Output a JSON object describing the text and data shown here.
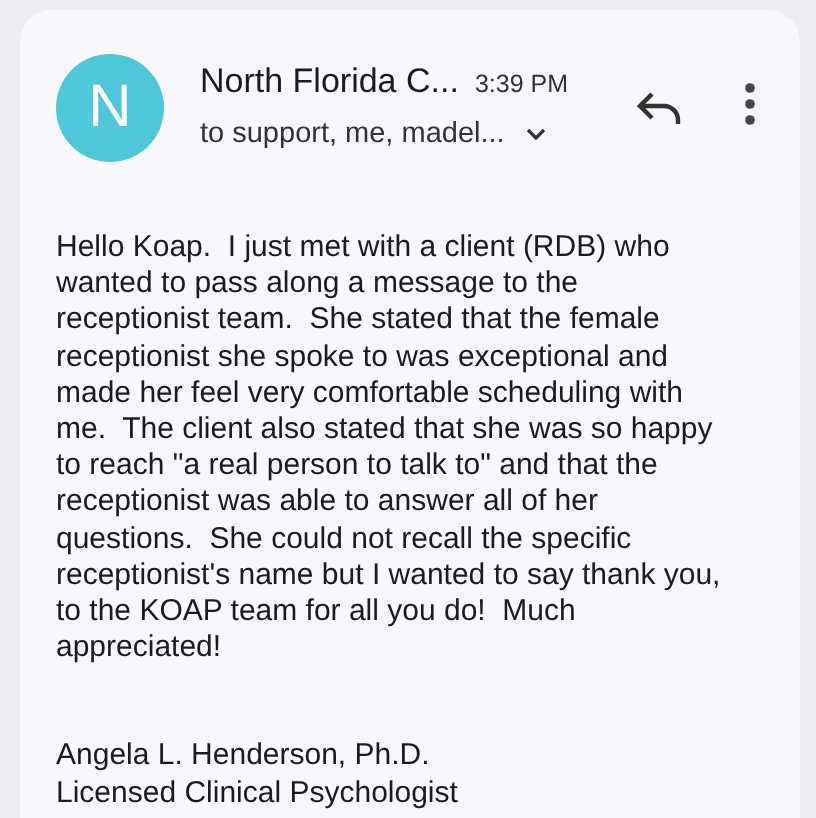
{
  "sender": {
    "initial": "N",
    "name": "North Florida C...",
    "time": "3:39 PM",
    "recipients": "to support, me, madel..."
  },
  "body": {
    "lines": [
      "Hello Koap.  I just met with a client (RDB) who",
      "wanted to pass along a message to the",
      "receptionist team.  She stated that the female",
      "receptionist she spoke to was exceptional and",
      "made her feel very comfortable scheduling with",
      "me.  The client also stated that she was so happy",
      "to reach \"a real person to talk to\" and that the",
      "receptionist was able to answer all of her",
      "questions.  She could not recall the specific",
      "receptionist's name but I wanted to say thank you,",
      "to the KOAP team for all you do!  Much",
      "appreciated!"
    ]
  },
  "signature": [
    "Angela L. Henderson, Ph.D.",
    "Licensed Clinical Psychologist"
  ]
}
